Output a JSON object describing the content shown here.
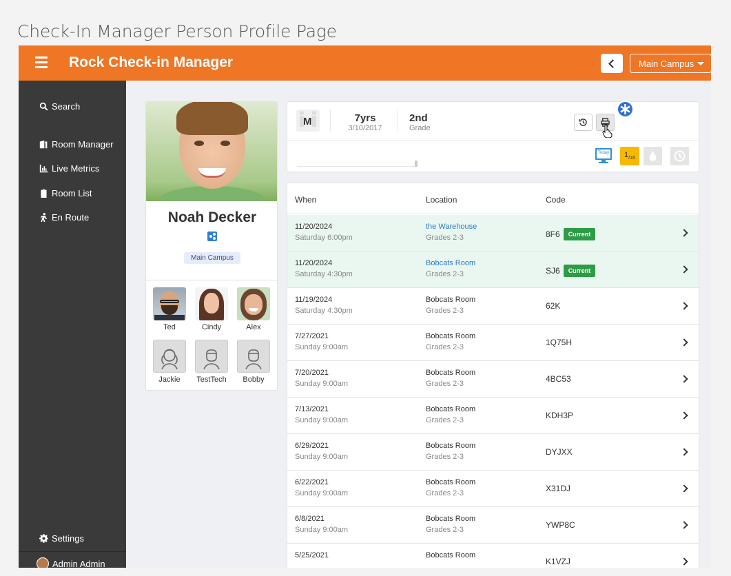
{
  "caption": "Check-In Manager Person Profile Page",
  "topbar": {
    "title": "Rock Check-in Manager",
    "campus": "Main Campus",
    "accent": "#ee7625"
  },
  "sidebar": {
    "items": [
      {
        "label": "Search",
        "icon": "search-icon"
      },
      {
        "label": "Room Manager",
        "icon": "door-icon"
      },
      {
        "label": "Live Metrics",
        "icon": "chart-icon"
      },
      {
        "label": "Room List",
        "icon": "clipboard-icon"
      },
      {
        "label": "En Route",
        "icon": "walking-icon"
      }
    ],
    "settings": "Settings",
    "user": "Admin Admin"
  },
  "person": {
    "name": "Noah Decker",
    "campus": "Main Campus",
    "gender": "M",
    "age": "7yrs",
    "birthdate": "3/10/2017",
    "grade": "2nd",
    "grade_label": "Grade"
  },
  "family": [
    {
      "name": "Ted"
    },
    {
      "name": "Cindy"
    },
    {
      "name": "Alex"
    },
    {
      "name": "Jackie"
    },
    {
      "name": "TestTech"
    },
    {
      "name": "Bobby"
    }
  ],
  "badges": {
    "today": "Today",
    "count": "1",
    "count_of": "/16"
  },
  "history": {
    "headers": {
      "when": "When",
      "location": "Location",
      "code": "Code"
    },
    "current_label": "Current",
    "rows": [
      {
        "date": "11/20/2024",
        "time": "Saturday 6:00pm",
        "room": "the Warehouse",
        "group": "Grades 2-3",
        "code": "8F6"
      },
      {
        "date": "11/20/2024",
        "time": "Saturday 4:30pm",
        "room": "Bobcats Room",
        "group": "Grades 2-3",
        "code": "SJ6"
      },
      {
        "date": "11/19/2024",
        "time": "Saturday 4:30pm",
        "room": "Bobcats Room",
        "group": "Grades 2-3",
        "code": "62K"
      },
      {
        "date": "7/27/2021",
        "time": "Sunday 9:00am",
        "room": "Bobcats Room",
        "group": "Grades 2-3",
        "code": "1Q75H"
      },
      {
        "date": "7/20/2021",
        "time": "Sunday 9:00am",
        "room": "Bobcats Room",
        "group": "Grades 2-3",
        "code": "4BC53"
      },
      {
        "date": "7/13/2021",
        "time": "Sunday 9:00am",
        "room": "Bobcats Room",
        "group": "Grades 2-3",
        "code": "KDH3P"
      },
      {
        "date": "6/29/2021",
        "time": "Sunday 9:00am",
        "room": "Bobcats Room",
        "group": "Grades 2-3",
        "code": "DYJXX"
      },
      {
        "date": "6/22/2021",
        "time": "Sunday 9:00am",
        "room": "Bobcats Room",
        "group": "Grades 2-3",
        "code": "X31DJ"
      },
      {
        "date": "6/8/2021",
        "time": "Sunday 9:00am",
        "room": "Bobcats Room",
        "group": "Grades 2-3",
        "code": "YWP8C"
      },
      {
        "date": "5/25/2021",
        "time": "",
        "room": "Bobcats Room",
        "group": "",
        "code": "K1VZJ"
      }
    ]
  }
}
